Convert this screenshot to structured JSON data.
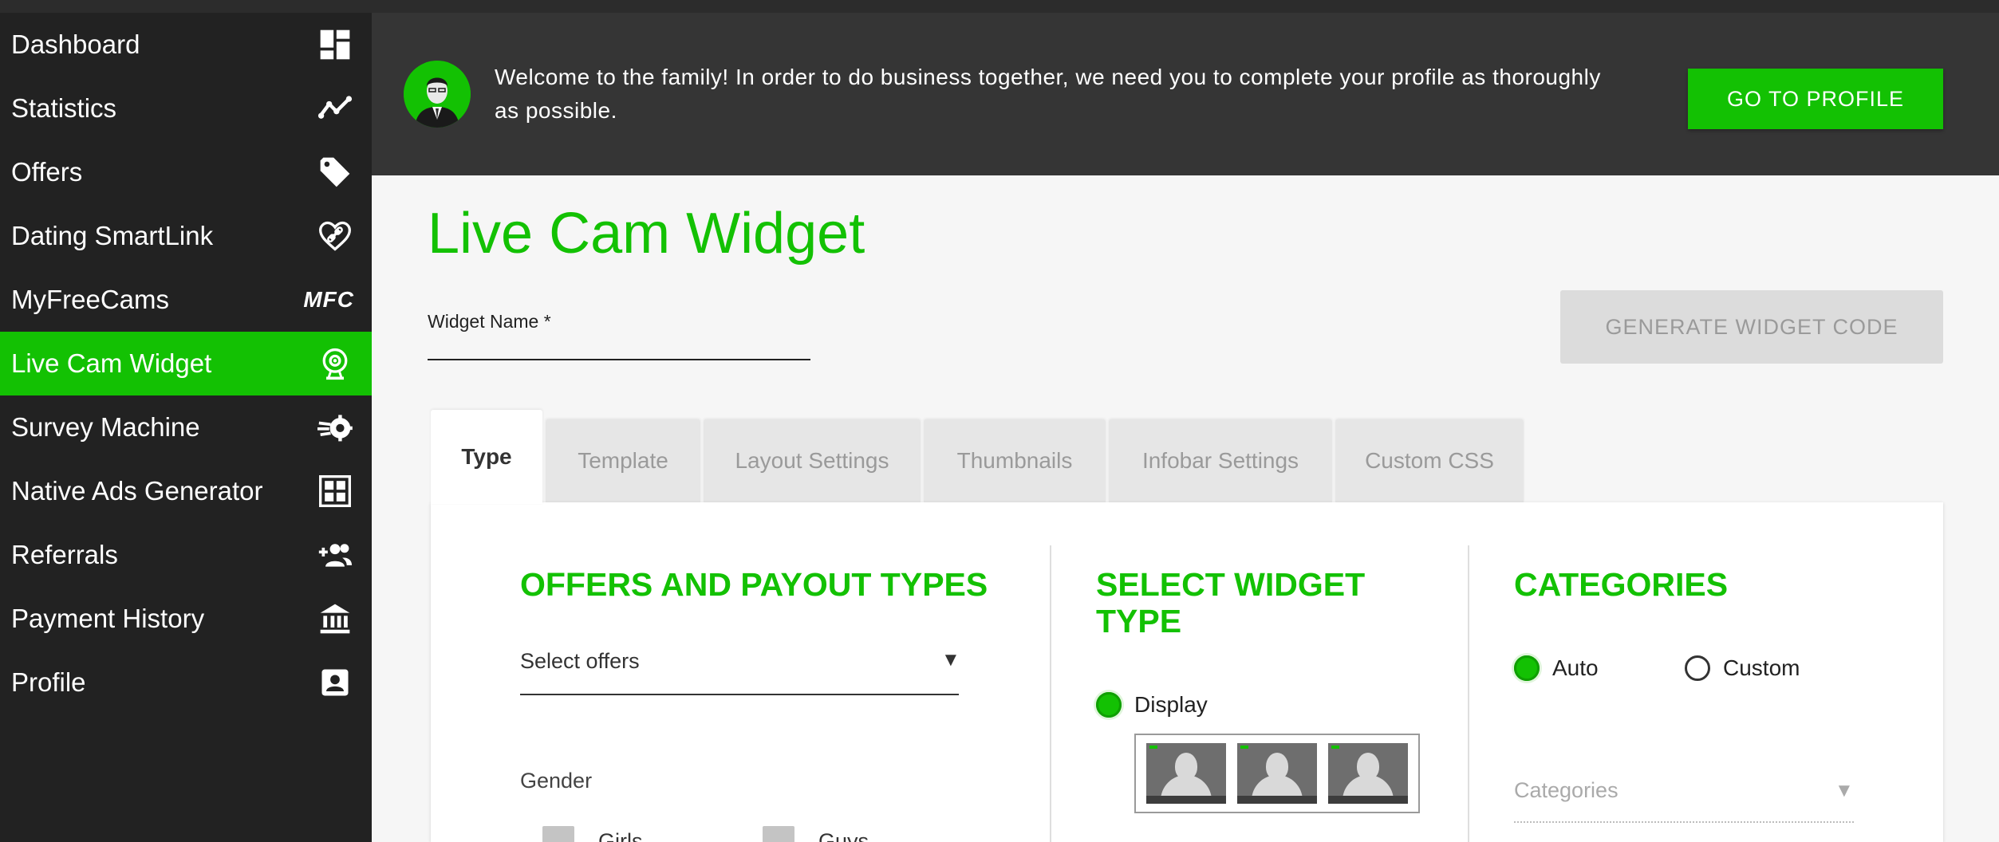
{
  "sidebar": {
    "items": [
      {
        "label": "Dashboard",
        "icon": "dashboard-icon"
      },
      {
        "label": "Statistics",
        "icon": "chart-line-icon"
      },
      {
        "label": "Offers",
        "icon": "tag-icon"
      },
      {
        "label": "Dating SmartLink",
        "icon": "heart-link-icon"
      },
      {
        "label": "MyFreeCams",
        "icon": "mfc-logo-icon",
        "icon_text": "MFC"
      },
      {
        "label": "Live Cam Widget",
        "icon": "webcam-icon",
        "active": true
      },
      {
        "label": "Survey Machine",
        "icon": "gear-rocket-icon"
      },
      {
        "label": "Native Ads Generator",
        "icon": "grid-icon"
      },
      {
        "label": "Referrals",
        "icon": "add-user-icon"
      },
      {
        "label": "Payment History",
        "icon": "bank-icon"
      },
      {
        "label": "Profile",
        "icon": "profile-card-icon"
      }
    ]
  },
  "banner": {
    "message": "Welcome to the family! In order to do business together, we need you to complete your profile as thoroughly as possible.",
    "button_label": "GO TO PROFILE"
  },
  "page": {
    "title": "Live Cam Widget",
    "widget_name_label": "Widget Name *",
    "generate_button": "GENERATE WIDGET CODE"
  },
  "tabs": [
    "Type",
    "Template",
    "Layout Settings",
    "Thumbnails",
    "Infobar Settings",
    "Custom CSS"
  ],
  "offers_section": {
    "title": "OFFERS AND PAYOUT TYPES",
    "select_placeholder": "Select offers",
    "gender_label": "Gender",
    "gender_options": [
      "Girls",
      "Guys"
    ]
  },
  "widget_type_section": {
    "title_line1": "SELECT WIDGET",
    "title_line2": "TYPE",
    "option_display": "Display"
  },
  "categories_section": {
    "title": "CATEGORIES",
    "option_auto": "Auto",
    "option_custom": "Custom",
    "select_placeholder": "Categories"
  },
  "colors": {
    "accent": "#13c103",
    "sidebar_bg": "#222222",
    "banner_bg": "#353535"
  }
}
